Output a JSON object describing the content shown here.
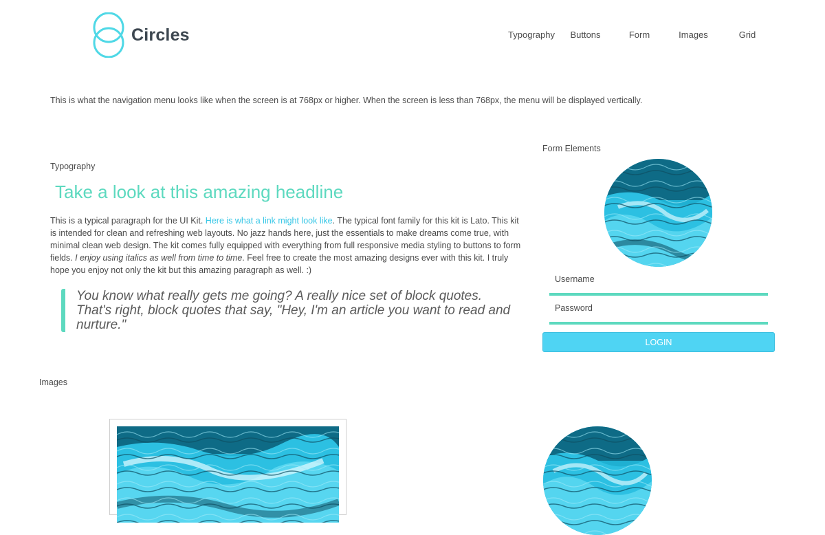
{
  "brand": {
    "name": "Circles"
  },
  "nav": {
    "items": [
      "Typography",
      "Buttons",
      "Form",
      "Images",
      "Grid"
    ]
  },
  "nav_note": "This is what the navigation menu looks like when the screen is at 768px or higher. When the screen is less than 768px, the menu will be displayed vertically.",
  "typography": {
    "section_label": "Typography",
    "headline": "Take a look at this amazing headline",
    "paragraph": {
      "text_before_link": "This is a typical paragraph for the UI Kit. ",
      "link_text": "Here is what a link might look like",
      "text_after_link": ". The typical font family for this kit is Lato. This kit is intended for clean and refreshing web layouts. No jazz hands here, just the essentials to make dreams come true, with minimal clean web design. The kit comes fully equipped with everything from full responsive media styling to buttons to form fields. ",
      "italic_text": "I enjoy using italics as well from time to time",
      "text_end": ". Feel free to create the most amazing designs ever with this kit. I truly hope you enjoy not only the kit but this amazing paragraph as well. :)"
    },
    "blockquote": "You know what really gets me going? A really nice set of block quotes. That's right, block quotes that say, \"Hey, I'm an article you want to read and nurture.\""
  },
  "form": {
    "section_label": "Form Elements",
    "username_placeholder": "Username",
    "password_placeholder": "Password",
    "login_label": "LOGIN"
  },
  "images": {
    "section_label": "Images"
  },
  "colors": {
    "accent_green": "#5dd9bf",
    "accent_blue": "#4fd4f3",
    "link_blue": "#35c6e6",
    "logo_ring": "#4fd8e6",
    "image_tint": "#22b6d6"
  },
  "icons": {
    "logo": "circles-logo-icon"
  }
}
